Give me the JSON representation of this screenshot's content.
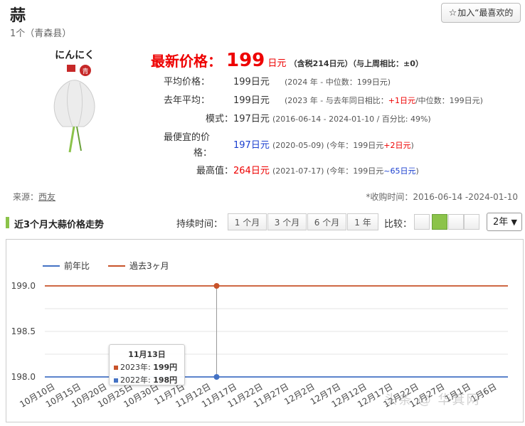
{
  "header": {
    "title": "蒜",
    "subtitle": "1个（青森县）",
    "fav_star": "☆",
    "fav_label": "加入“最喜欢的"
  },
  "product_image": {
    "caption": "にんにく",
    "badge": "青"
  },
  "price": {
    "latest_label": "最新价格：",
    "latest_value": "199",
    "latest_unit": "日元",
    "latest_note": "（含税214日元）（与上周相比：±0）",
    "avg_label": "平均价格：",
    "avg_value": "199日元",
    "avg_note": "(2024 年 - 中位数：199日元)",
    "lastyear_label": "去年平均：",
    "lastyear_value": "199日元",
    "lastyear_note_a": "(2023 年 - 与去年同日相比：",
    "lastyear_diff": "+1日元",
    "lastyear_note_b": "/中位数：199日元)",
    "mode_label": "模式：",
    "mode_value": "197日元",
    "mode_note": "(2016-06-14 - 2024-01-10 / 百分比: 49%)",
    "cheapest_label_1": "最便宜的价",
    "cheapest_label_2": "格：",
    "cheapest_value": "197日元",
    "cheapest_note_a": "(2020-05-09) (今年：199日元",
    "cheapest_diff": "+2日元",
    "cheapest_note_b": ")",
    "highest_label": "最高值：",
    "highest_value": "264日元",
    "highest_note_a": "(2021-07-17) (今年：199日元",
    "highest_diff": "~65日元",
    "highest_note_b": ")"
  },
  "source": {
    "label": "来源：",
    "link": "西友"
  },
  "collected": "*收购时间：2016-06-14 -2024-01-10",
  "trend": {
    "title": "近3个月大蒜价格走势",
    "duration_label": "持续时间：",
    "durations": [
      "1 个月",
      "3 个月",
      "6 个月",
      "1 年"
    ],
    "compare_label": "比较：",
    "year_select": "2年",
    "accent_color": "#8bc34a"
  },
  "tooltip": {
    "date": "11月13日",
    "line1_label": "2023年: ",
    "line1_value": "199円",
    "line2_label": "2022年: ",
    "line2_value": "198円"
  },
  "watermark": "头条 @ 华箕网",
  "chart_data": {
    "type": "line",
    "legend_position": "top-left",
    "x": [
      "10月10日",
      "10月15日",
      "10月20日",
      "10月25日",
      "10月30日",
      "11月7日",
      "11月12日",
      "11月17日",
      "11月22日",
      "11月27日",
      "12月2日",
      "12月7日",
      "12月12日",
      "12月17日",
      "12月22日",
      "12月27日",
      "1月1日",
      "1月6日"
    ],
    "ylim": [
      198.0,
      199.0
    ],
    "yticks": [
      "199.0",
      "198.5",
      "198.0"
    ],
    "grid": true,
    "series": [
      {
        "name": "前年比",
        "color": "#4472c4",
        "values": [
          198,
          198,
          198,
          198,
          198,
          198,
          198,
          198,
          198,
          198,
          198,
          198,
          198,
          198,
          198,
          198,
          198,
          198
        ]
      },
      {
        "name": "過去3ヶ月",
        "color": "#c8532a",
        "values": [
          199,
          199,
          199,
          199,
          199,
          199,
          199,
          199,
          199,
          199,
          199,
          199,
          199,
          199,
          199,
          199,
          199,
          199
        ]
      }
    ]
  }
}
